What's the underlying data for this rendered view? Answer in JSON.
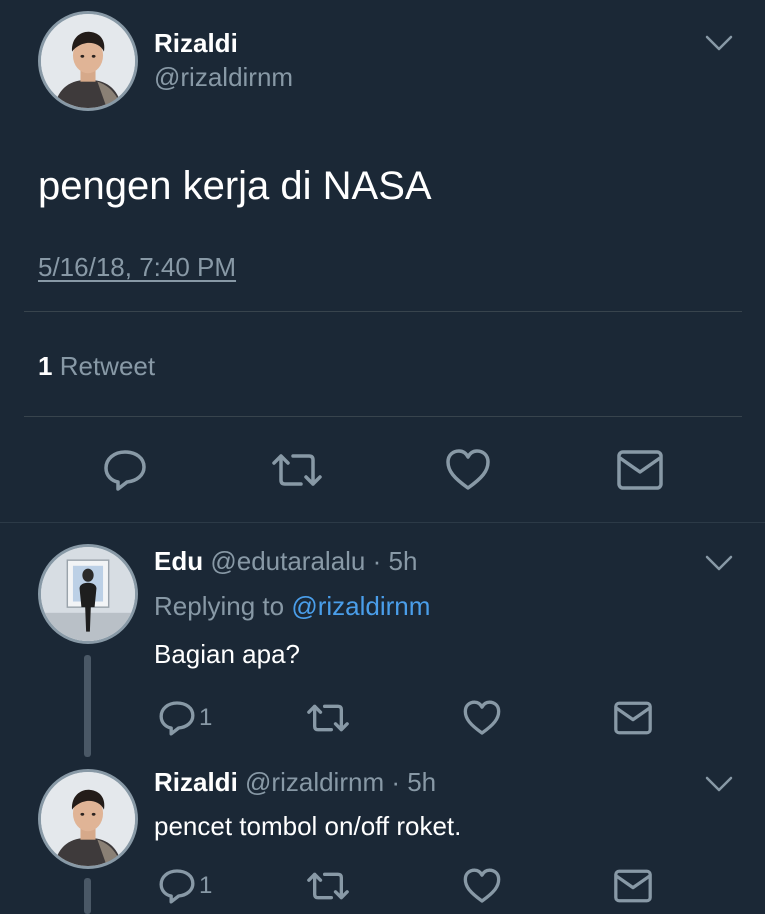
{
  "main_tweet": {
    "name": "Rizaldi",
    "handle": "@rizaldirnm",
    "text": "pengen kerja di NASA",
    "timestamp": "5/16/18, 7:40 PM",
    "retweet_count": "1",
    "retweet_label": "Retweet",
    "actions": [
      "reply-icon",
      "retweet-icon",
      "like-icon",
      "message-icon"
    ]
  },
  "replies": [
    {
      "name": "Edu",
      "handle_time": "@edutaralalu · 5h",
      "replying_prefix": "Replying to",
      "replying_to": "@rizaldirnm",
      "text": "Bagian apa?",
      "reply_count": "1"
    },
    {
      "name": "Rizaldi",
      "handle_time": "@rizaldirnm · 5h",
      "text": "pencet tombol on/off roket.",
      "reply_count": "1"
    }
  ],
  "colors": {
    "background": "#1b2836",
    "text_primary": "#ffffff",
    "text_secondary": "#8899a6",
    "link": "#4a9eea",
    "divider": "#38444d"
  }
}
